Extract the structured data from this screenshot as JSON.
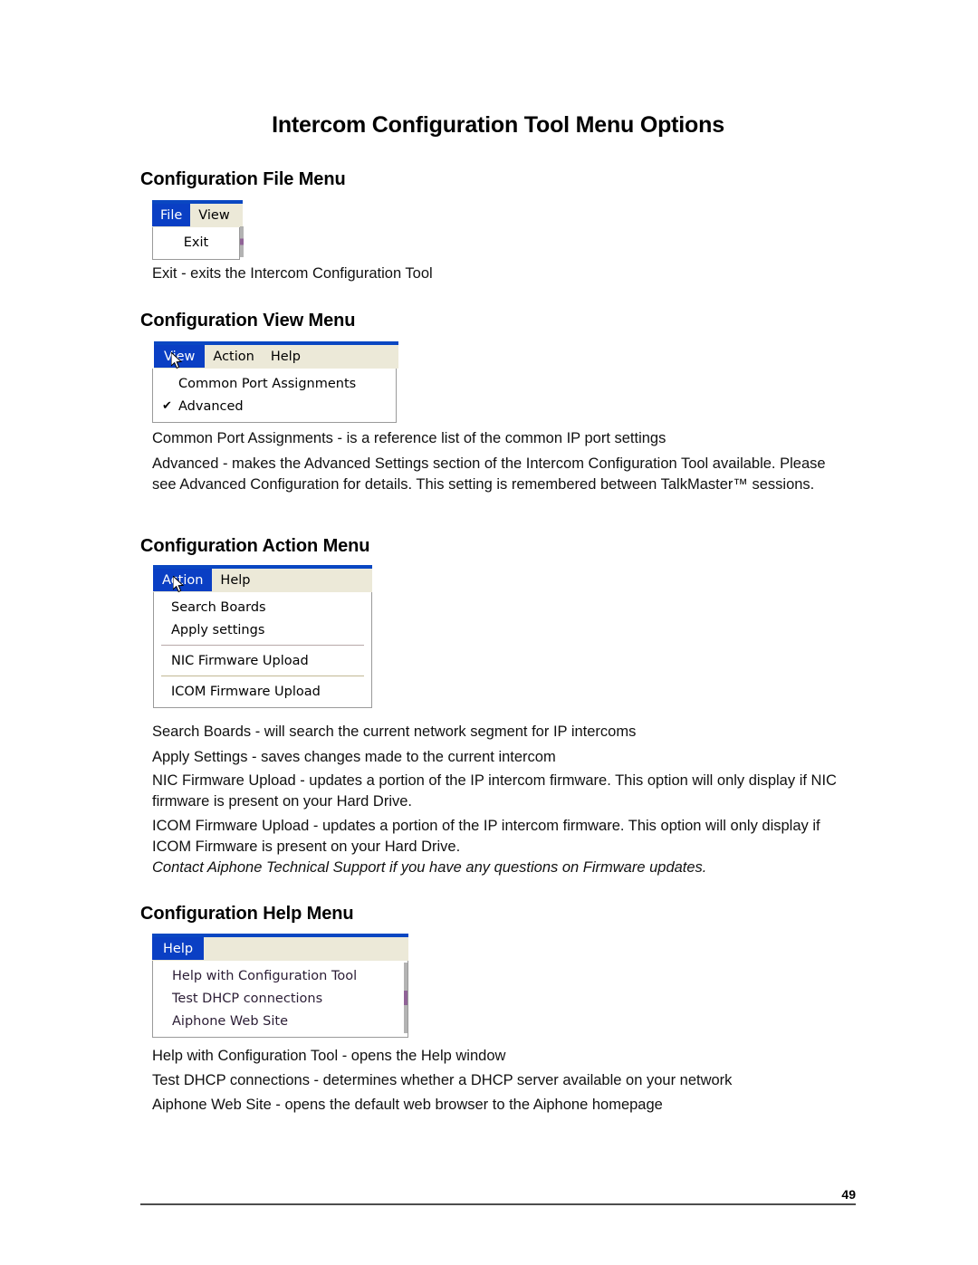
{
  "document": {
    "title": "Intercom Configuration Tool Menu Options",
    "page_number": "49"
  },
  "sections": [
    {
      "heading": "Configuration File Menu",
      "menu": {
        "bar_items": [
          "File",
          "View"
        ],
        "selected": "File",
        "items": [
          "Exit"
        ]
      },
      "paragraphs": [
        "Exit - exits the Intercom Configuration Tool"
      ]
    },
    {
      "heading": "Configuration View Menu",
      "menu": {
        "bar_items": [
          "View",
          "Action",
          "Help"
        ],
        "selected": "View",
        "items": [
          "Common Port Assignments",
          "Advanced"
        ],
        "checked": [
          "Advanced"
        ]
      },
      "paragraphs": [
        "Common Port Assignments - is a reference list of the common IP port settings",
        "Advanced - makes the Advanced Settings section of the Intercom Configuration Tool available. Please see Advanced Configuration for details.  This setting is remembered between TalkMaster™ sessions."
      ]
    },
    {
      "heading": "Configuration Action Menu",
      "menu": {
        "bar_items": [
          "Action",
          "Help"
        ],
        "selected": "Action",
        "items": [
          "Search Boards",
          "Apply settings",
          "NIC Firmware Upload",
          "ICOM Firmware Upload"
        ]
      },
      "paragraphs": [
        "Search Boards - will search the current network segment for IP intercoms",
        "Apply Settings - saves changes made to the current intercom",
        "NIC Firmware Upload - updates a portion of the IP intercom firmware.  This option will only display if NIC firmware is present on your Hard Drive.",
        "ICOM Firmware Upload - updates a portion of the IP intercom firmware.  This option will only display if ICOM Firmware is present on your Hard Drive.",
        "Contact Aiphone Technical Support if you have any questions on Firmware updates."
      ]
    },
    {
      "heading": "Configuration Help Menu",
      "menu": {
        "bar_items": [
          "Help"
        ],
        "selected": "Help",
        "items": [
          "Help with Configuration Tool",
          "Test DHCP connections",
          "Aiphone Web Site"
        ]
      },
      "paragraphs": [
        "Help with Configuration Tool - opens the Help window",
        "Test DHCP connections - determines whether a DHCP server available on your network",
        "Aiphone Web Site - opens the default web browser to the Aiphone homepage"
      ]
    }
  ],
  "colors": {
    "menu_selected_bg": "#0a3fc4",
    "menu_bar_bg": "#ece9d8",
    "titlebar_blue": "#0a47c2",
    "menu_bg": "#ffffff"
  },
  "icons": {
    "check": "✔",
    "cursor": "mouse-pointer-arrow"
  }
}
